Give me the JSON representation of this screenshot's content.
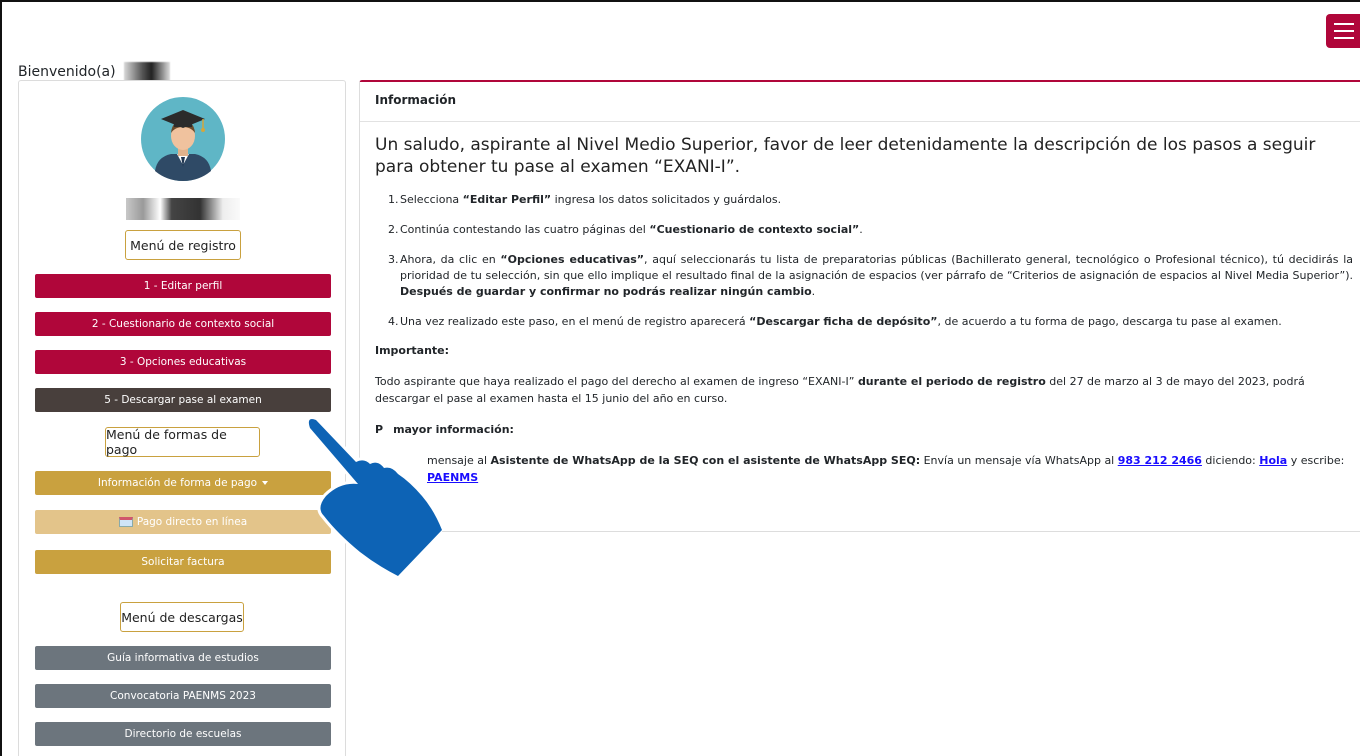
{
  "header": {
    "welcome_label": "Bienvenido(a)",
    "hamburger_icon": "menu-icon"
  },
  "sidebar": {
    "avatar_icon": "graduate-avatar-icon",
    "registration_menu": "Menú de registro",
    "registration_items": [
      "1 - Editar perfil",
      "2 - Cuestionario de contexto social",
      "3 - Opciones educativas",
      "5 - Descargar pase al examen"
    ],
    "payment_menu": "Menú de formas de pago",
    "payment_info": "Información de forma de pago",
    "direct_payment": "Pago directo en línea",
    "invoice": "Solicitar factura",
    "downloads_menu": "Menú de descargas",
    "download_items": [
      "Guía informativa de estudios",
      "Convocatoria PAENMS 2023",
      "Directorio de escuelas"
    ]
  },
  "panel": {
    "title": "Información",
    "intro": "Un saludo, aspirante al Nivel Medio Superior, favor de leer detenidamente la descripción de los pasos a seguir para obtener tu pase al examen “EXANI-I”.",
    "steps": [
      {
        "num": "1.",
        "a": "Selecciona ",
        "b": "“Editar Perfil”",
        "c": " ingresa los datos solicitados y guárdalos."
      },
      {
        "num": "2.",
        "a": "Continúa contestando las cuatro páginas del ",
        "b": "“Cuestionario de contexto social”",
        "c": "."
      },
      {
        "num": "3.",
        "a": "Ahora, da clic en ",
        "b": "“Opciones educativas”",
        "c": ", aquí seleccionarás tu lista de preparatorias públicas (Bachillerato general, tecnológico o Profesional técnico), tú decidirás la prioridad de tu selección, sin que ello implique el resultado final de la asignación de espacios (ver párrafo de “Criterios de asignación de espacios al Nivel Media Superior”). ",
        "d": "Después de guardar y confirmar no podrás realizar ningún cambio",
        "e": "."
      },
      {
        "num": "4.",
        "a": "Una vez realizado este paso, en el menú de registro aparecerá ",
        "b": "“Descargar ficha de depósito”",
        "c": ", de acuerdo a tu forma de pago, descarga tu pase al examen."
      }
    ],
    "important_title": "Importante:",
    "important": {
      "a": "Todo aspirante que haya realizado el pago del derecho al examen de ingreso “EXANI-I” ",
      "b": "durante el periodo de registro",
      "c": " del 27 de marzo al 3 de mayo del 2023, podrá descargar el pase al examen hasta el 15 junio del año en curso."
    },
    "more_info_title": "P",
    "more_info_title_rest": "mayor información:",
    "contact": {
      "a": "mensaje al ",
      "b": "Asistente de WhatsApp de la SEQ con el asistente de WhatsApp SEQ:",
      "c": " Envía un mensaje vía WhatsApp al ",
      "phone": "983 212 2466",
      "d": " diciendo: ",
      "hola": "Hola",
      "e": " y escribe: ",
      "code": "PAENMS"
    }
  },
  "colors": {
    "primary": "#b0063a",
    "dark": "#483f3c",
    "gold": "#c9a13f",
    "gray": "#6c757d"
  }
}
